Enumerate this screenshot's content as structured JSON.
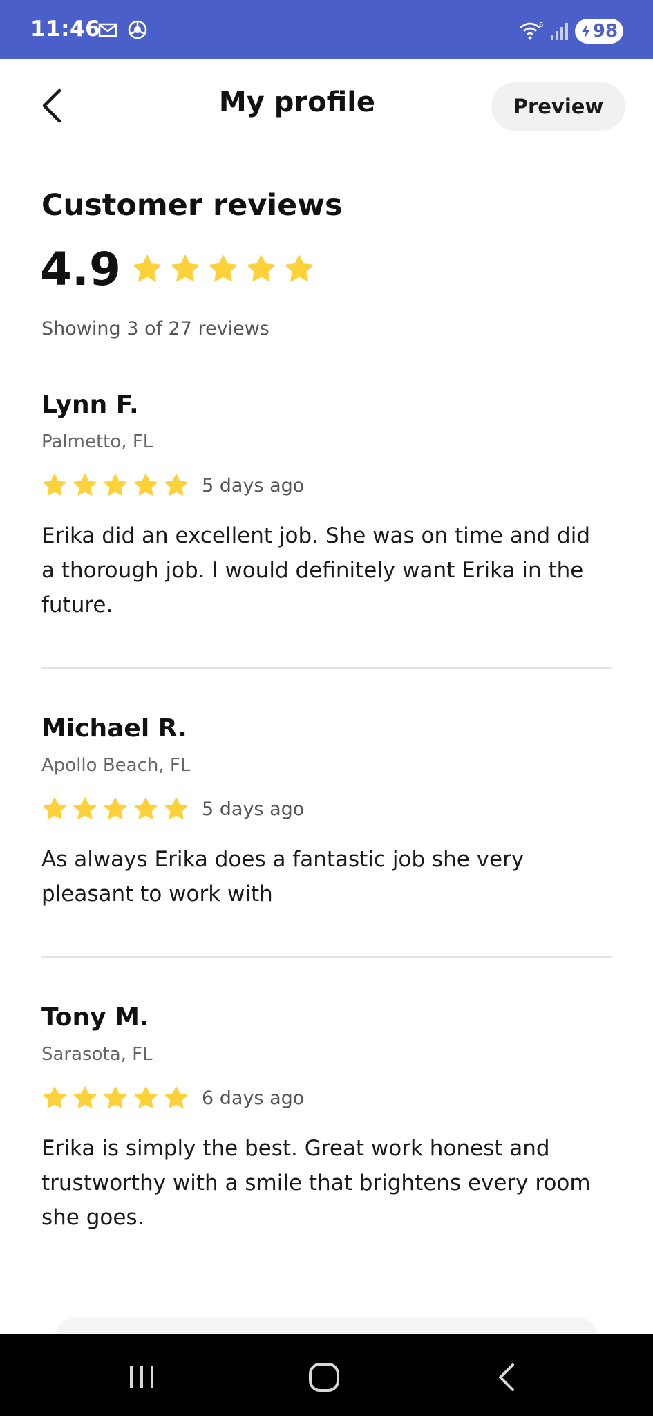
{
  "status_bar": {
    "time": "11:46",
    "battery": "98",
    "icons": [
      "gmail-icon",
      "chrome-icon",
      "wifi-icon",
      "signal-icon",
      "battery-charging-icon"
    ]
  },
  "header": {
    "title": "My profile",
    "preview_label": "Preview",
    "back_icon": "chevron-left-icon"
  },
  "reviews_section": {
    "title": "Customer reviews",
    "average": "4.9",
    "average_stars": 5,
    "showing": "Showing 3 of 27 reviews"
  },
  "reviews": [
    {
      "name": "Lynn F.",
      "location": "Palmetto, FL",
      "stars": 5,
      "date": "5 days ago",
      "text": "Erika did an excellent job. She was on time and did a thorough job. I would definitely want Erika in the future."
    },
    {
      "name": "Michael R.",
      "location": "Apollo Beach, FL",
      "stars": 5,
      "date": "5 days ago",
      "text": "As always Erika does a fantastic job she very pleasant to work with"
    },
    {
      "name": "Tony M.",
      "location": "Sarasota, FL",
      "stars": 5,
      "date": "6 days ago",
      "text": "Erika is simply the best. Great work honest and trustworthy with a smile that brightens every room she goes."
    }
  ],
  "colors": {
    "status_bar": "#4a5fc9",
    "star": "#fdd13a",
    "divider": "#e4e4e4",
    "preview_bg": "#f1f1f1"
  },
  "nav_bar": {
    "icons": [
      "recent-apps-icon",
      "home-icon",
      "back-icon"
    ]
  }
}
